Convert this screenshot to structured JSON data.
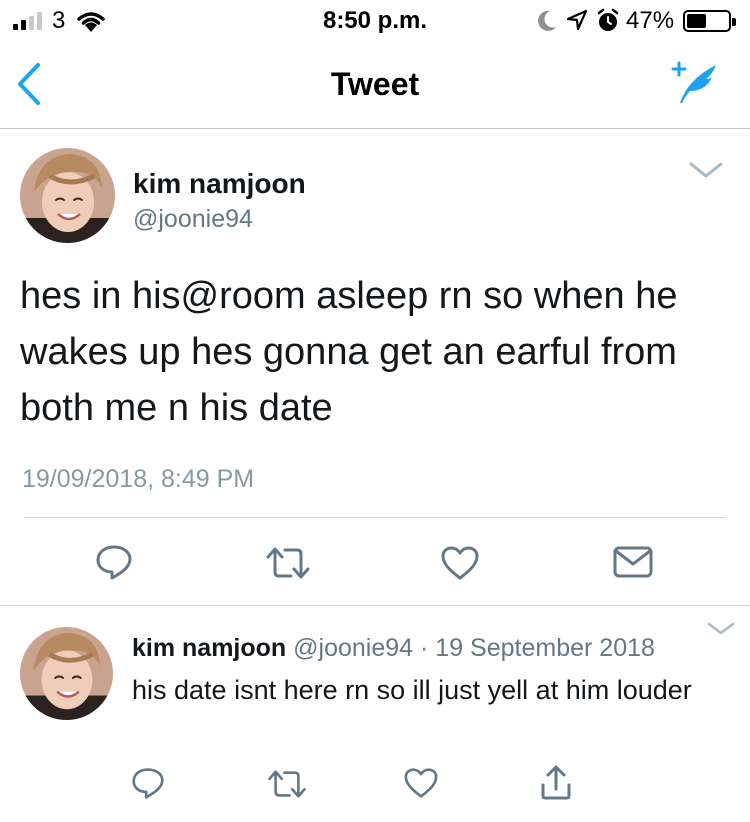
{
  "status_bar": {
    "carrier": "3",
    "time": "8:50 p.m.",
    "battery_percent": "47%",
    "battery_level": 0.47,
    "icons": [
      "signal-icon",
      "wifi-icon",
      "moon-icon",
      "location-arrow-icon",
      "alarm-icon",
      "battery-icon"
    ]
  },
  "nav": {
    "title": "Tweet",
    "back_icon": "chevron-left-icon",
    "compose_icon": "compose-tweet-icon"
  },
  "main_tweet": {
    "name": "kim namjoon",
    "handle": "@joonie94",
    "text": "hes in his@room asleep rn so when he wakes up hes gonna get an earful from both me n his date",
    "timestamp": "19/09/2018, 8:49 PM",
    "actions": [
      "reply-icon",
      "retweet-icon",
      "like-icon",
      "message-icon"
    ]
  },
  "reply_tweet": {
    "name": "kim namjoon",
    "handle": "@joonie94",
    "separator": "·",
    "date": "19 September 2018",
    "text": "his date isnt here rn so ill just yell at him louder",
    "actions": [
      "reply-icon",
      "retweet-icon",
      "like-icon",
      "share-icon"
    ]
  },
  "colors": {
    "accent": "#1da1f2",
    "icon_gray": "#657786",
    "text": "#14171a",
    "muted": "#8899a6"
  }
}
